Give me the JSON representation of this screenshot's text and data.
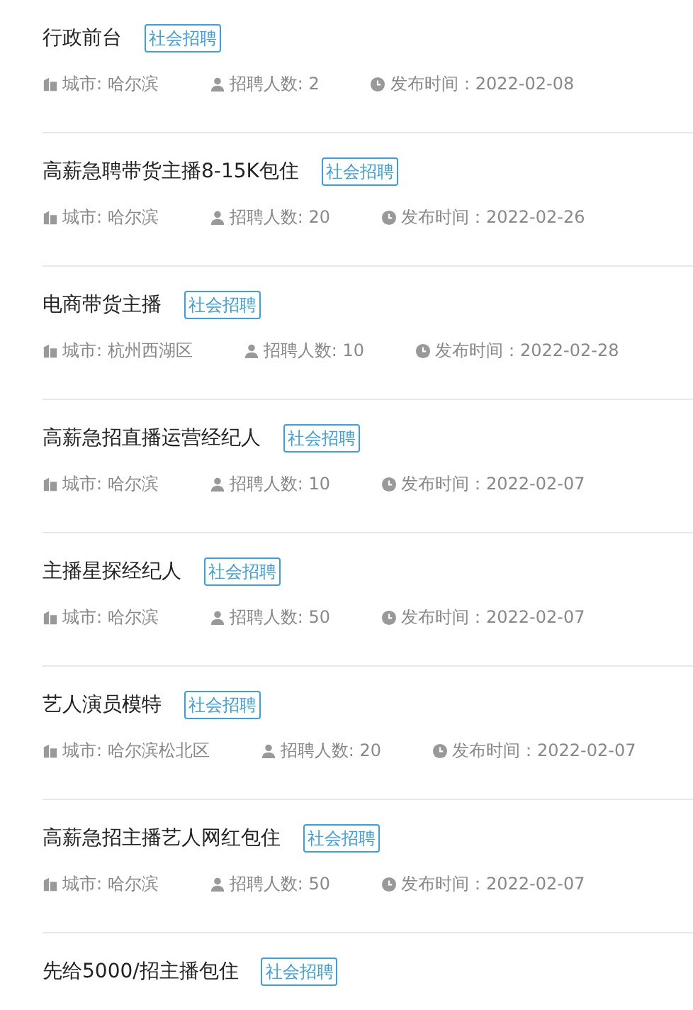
{
  "jobs": [
    {
      "title": "行政前台",
      "tag": "社会招聘",
      "city": "城市: 哈尔滨",
      "count": "招聘人数: 2",
      "date": "发布时间：2022-02-08"
    },
    {
      "title": "高薪急聘带货主播8-15K包住",
      "tag": "社会招聘",
      "city": "城市: 哈尔滨",
      "count": "招聘人数: 20",
      "date": "发布时间：2022-02-26"
    },
    {
      "title": "电商带货主播",
      "tag": "社会招聘",
      "city": "城市: 杭州西湖区",
      "count": "招聘人数: 10",
      "date": "发布时间：2022-02-28"
    },
    {
      "title": "高薪急招直播运营经纪人",
      "tag": "社会招聘",
      "city": "城市: 哈尔滨",
      "count": "招聘人数: 10",
      "date": "发布时间：2022-02-07"
    },
    {
      "title": "主播星探经纪人",
      "tag": "社会招聘",
      "city": "城市: 哈尔滨",
      "count": "招聘人数: 50",
      "date": "发布时间：2022-02-07"
    },
    {
      "title": "艺人演员模特",
      "tag": "社会招聘",
      "city": "城市: 哈尔滨松北区",
      "count": "招聘人数: 20",
      "date": "发布时间：2022-02-07"
    },
    {
      "title": "高薪急招主播艺人网红包住",
      "tag": "社会招聘",
      "city": "城市: 哈尔滨",
      "count": "招聘人数: 50",
      "date": "发布时间：2022-02-07"
    },
    {
      "title": "先给5000/招主播包住",
      "tag": "社会招聘"
    }
  ]
}
